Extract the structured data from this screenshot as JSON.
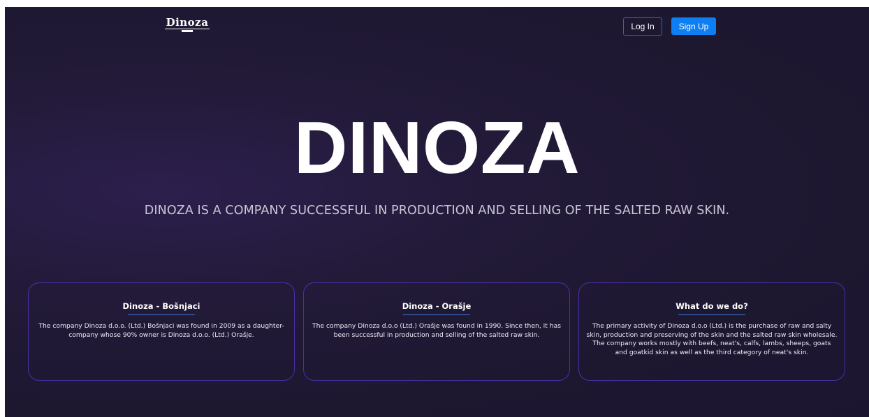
{
  "header": {
    "logo_text": "Dinoza",
    "login_label": "Log In",
    "signup_label": "Sign Up"
  },
  "hero": {
    "title": "DINOZA",
    "subtitle": "DINOZA IS A COMPANY SUCCESSFUL IN PRODUCTION AND SELLING OF THE SALTED RAW SKIN."
  },
  "cards": [
    {
      "title": "Dinoza - Bošnjaci",
      "text": "The company Dinoza d.o.o. (Ltd.) Bošnjaci was found in 2009 as a daughter-company whose 90% owner is Dinoza d.o.o. (Ltd.) Orašje."
    },
    {
      "title": "Dinoza - Orašje",
      "text": "The company Dinoza d.o.o (Ltd.) Orašje was found in 1990. Since then, it has been successful in production and selling of the salted raw skin."
    },
    {
      "title": "What do we do?",
      "text": "The primary activity of Dinoza d.o.o (Ltd.) is the purchase of raw and salty skin, production and preserving of the skin and the salted raw skin wholesale. The company works mostly with beefs, neat's, calfs, lambs, sheeps, goats and goatkid skin as well as the third category of neat's skin."
    }
  ],
  "colors": {
    "background": "#1d1730",
    "accent_blue": "#0d7ff2",
    "card_border": "#4b2fa8",
    "underline": "#3a7bd5"
  }
}
